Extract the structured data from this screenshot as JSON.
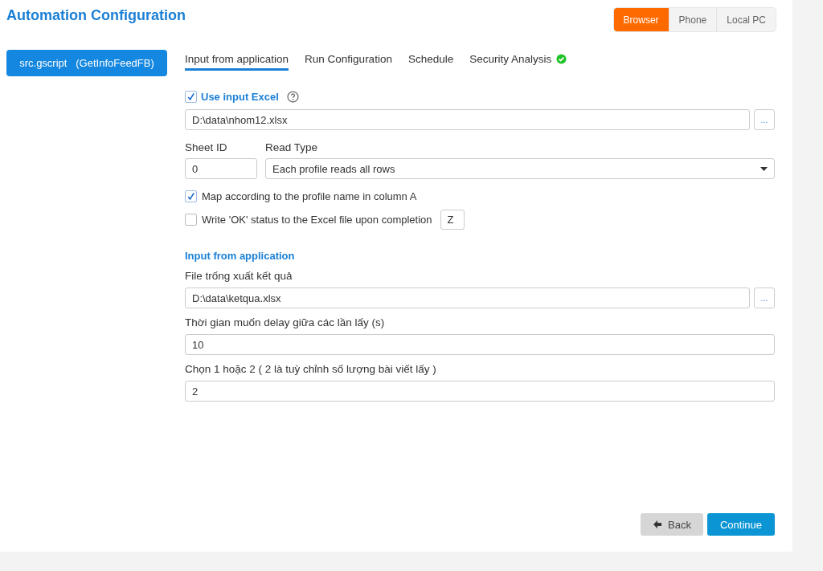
{
  "title": "Automation Configuration",
  "platform_tabs": [
    {
      "label": "Browser",
      "selected": true
    },
    {
      "label": "Phone",
      "selected": false
    },
    {
      "label": "Local PC",
      "selected": false
    }
  ],
  "script_button": {
    "label": "src.gscript   (GetInfoFeedFB)"
  },
  "tabs": [
    {
      "label": "Input from application",
      "selected": true,
      "verified": false
    },
    {
      "label": "Run Configuration",
      "selected": false,
      "verified": false
    },
    {
      "label": "Schedule",
      "selected": false,
      "verified": false
    },
    {
      "label": "Security Analysis",
      "selected": false,
      "verified": true
    }
  ],
  "excel": {
    "use_input": {
      "label": "Use input Excel",
      "checked": true
    },
    "path": "D:\\data\\nhom12.xlsx",
    "browse": "...",
    "sheet_id": {
      "label": "Sheet ID",
      "value": "0"
    },
    "read_type": {
      "label": "Read Type",
      "value": "Each profile reads all rows"
    },
    "options": [
      {
        "label": "Map according to the profile name in column A",
        "checked": true
      },
      {
        "label": "Write 'OK' status to the Excel file upon completion",
        "checked": false,
        "column": "Z"
      }
    ]
  },
  "section": {
    "title": "Input from application",
    "fields": [
      {
        "label": "File trống xuất kết quả",
        "value": "D:\\data\\ketqua.xlsx",
        "browse": "..."
      },
      {
        "label": "Thời gian muốn delay giữa các lần lấy (s)",
        "value": "10"
      },
      {
        "label": "Chọn 1 hoặc 2 ( 2 là tuỳ chỉnh số lượng bài viết lấy )",
        "value": "2"
      }
    ]
  },
  "buttons": [
    {
      "label": "Back",
      "kind": "back"
    },
    {
      "label": "Continue",
      "kind": "primary"
    }
  ]
}
